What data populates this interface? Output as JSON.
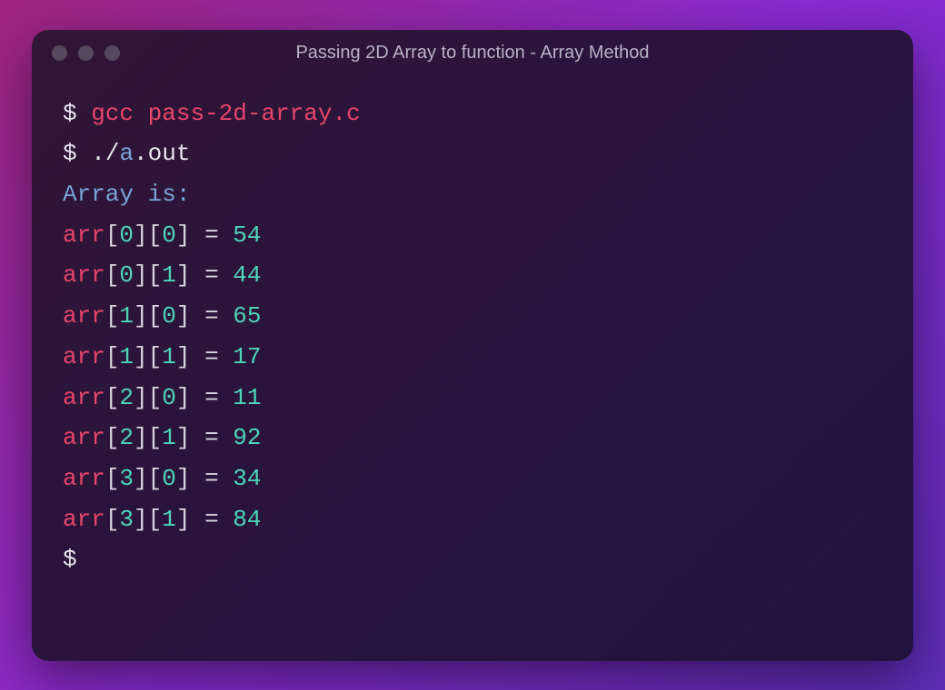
{
  "window": {
    "title": "Passing 2D Array to function - Array Method"
  },
  "terminal": {
    "prompt": "$",
    "compile_cmd": {
      "compiler": "gcc",
      "file": "pass-2d-array.c"
    },
    "run_cmd": {
      "dotslash": "./",
      "executable": "a",
      "ext": ".out"
    },
    "output_header": "Array is:",
    "array_name": "arr",
    "equals_sign": " = ",
    "entries": [
      {
        "i": "0",
        "j": "0",
        "value": "54"
      },
      {
        "i": "0",
        "j": "1",
        "value": "44"
      },
      {
        "i": "1",
        "j": "0",
        "value": "65"
      },
      {
        "i": "1",
        "j": "1",
        "value": "17"
      },
      {
        "i": "2",
        "j": "0",
        "value": "11"
      },
      {
        "i": "2",
        "j": "1",
        "value": "92"
      },
      {
        "i": "3",
        "j": "0",
        "value": "34"
      },
      {
        "i": "3",
        "j": "1",
        "value": "84"
      }
    ]
  }
}
